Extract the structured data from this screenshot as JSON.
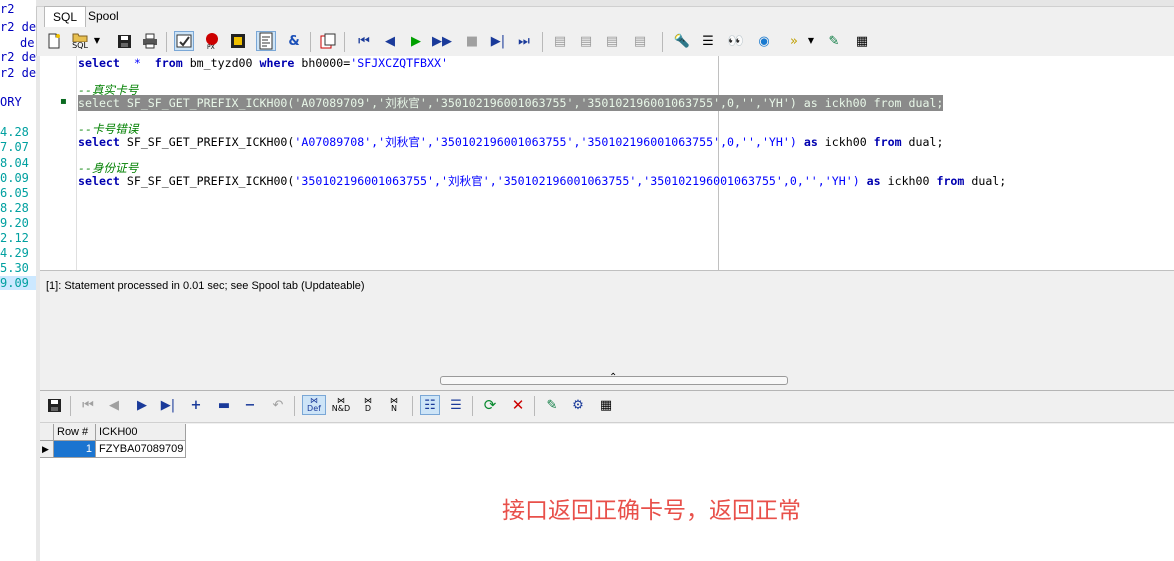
{
  "left_panel": {
    "fragments": [
      "r2",
      "r2 de",
      "de",
      "r2 de",
      "r2 de",
      "ORY",
      "4.28",
      "7.07",
      "8.04",
      "0.09",
      "6.05",
      "8.28",
      "9.20",
      "2.12",
      "4.29",
      "5.30",
      "9.09"
    ]
  },
  "tabs": [
    {
      "label": "SQL",
      "active": true
    },
    {
      "label": "Spool",
      "active": false
    }
  ],
  "toolbar": {
    "sql_label": "SQL",
    "icons": [
      "new-icon",
      "open-sql-icon",
      "dropdown-icon",
      "save-icon",
      "print-icon",
      "execute-icon",
      "explain-plan-icon",
      "commit-icon",
      "beautify-icon",
      "ampersand-icon",
      "copy-icon",
      "first-icon",
      "prior-icon",
      "run-icon",
      "run-to-end-icon",
      "stop-icon",
      "next-icon",
      "last-icon",
      "doc-1-icon",
      "doc-2-icon",
      "doc-3-icon",
      "doc-4-icon",
      "find-object-icon",
      "properties-icon",
      "binoculars-icon",
      "hint-icon",
      "highlight-icon",
      "dropdown-icon",
      "describe-icon",
      "grid-settings-icon"
    ]
  },
  "editor": {
    "line1": {
      "kw1": "select",
      "op": "  *  ",
      "kw2": "from",
      "mid": " bm_tyzd00 ",
      "kw3": "where",
      "tail": " bh0000=",
      "str": "'SFJXCZQTFBXX'"
    },
    "comment1": "--真实卡号",
    "line2": "select SF_SF_GET_PREFIX_ICKH00('A07089709','刘秋官','350102196001063755','350102196001063755',0,'','YH') as ickh00 from dual;",
    "comment2": "--卡号错误",
    "line3": {
      "kw1": "select",
      "fn": " SF_SF_GET_PREFIX_ICKH00(",
      "args": "'A07089708','刘秋官','350102196001063755','350102196001063755',0,'','YH')",
      "kw2": "as",
      "mid": " ickh00 ",
      "kw3": "from",
      "tail": " dual;"
    },
    "comment3": "--身份证号",
    "line4": {
      "kw1": "select",
      "fn": " SF_SF_GET_PREFIX_ICKH00(",
      "args": "'350102196001063755','刘秋官','350102196001063755','350102196001063755',0,'','YH')",
      "kw2": "as",
      "mid": " ickh00 ",
      "kw3": "from",
      "tail": " dual;"
    }
  },
  "status": {
    "message": "[1]: Statement processed in 0.01 sec; see Spool tab (Updateable)"
  },
  "grid": {
    "columns": [
      "Row #",
      "ICKH00"
    ],
    "rows": [
      {
        "row": "1",
        "ickh00": "FZYBA07089709"
      }
    ]
  },
  "grid_toolbar": {
    "def_label": "Def",
    "nd_label": "N&D",
    "d_label": "D",
    "n_label": "N"
  },
  "annotation": "接口返回正确卡号，返回正常",
  "colors": {
    "annotation": "#e8504a",
    "keyword": "#0000b0",
    "string": "#0000ff",
    "comment": "#008000",
    "highlight_bg": "#8a8a8a"
  }
}
